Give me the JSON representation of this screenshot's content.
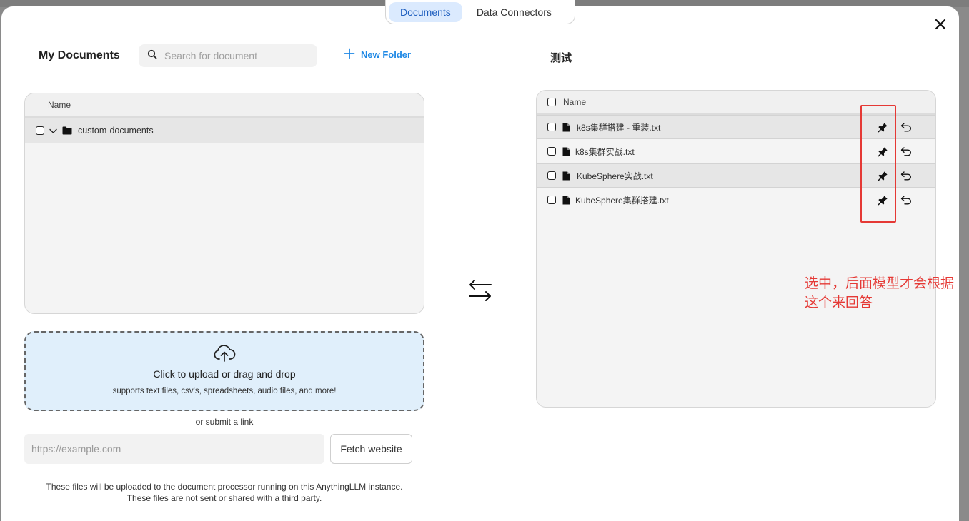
{
  "tabs": [
    {
      "label": "Documents",
      "active": true
    },
    {
      "label": "Data Connectors",
      "active": false
    }
  ],
  "my_documents": {
    "title": "My Documents",
    "search_placeholder": "Search for document",
    "new_folder_label": "New Folder",
    "column_name": "Name",
    "folders": [
      {
        "name": "custom-documents",
        "expanded": true
      }
    ]
  },
  "upload": {
    "title": "Click to upload or drag and drop",
    "subtitle": "supports text files, csv's, spreadsheets, audio files, and more!",
    "or_link": "or submit a link",
    "url_placeholder": "https://example.com",
    "fetch_label": "Fetch website",
    "disclaimer_line1": "These files will be uploaded to the document processor running on this AnythingLLM instance.",
    "disclaimer_line2": "These files are not sent or shared with a third party."
  },
  "workspace": {
    "title": "测试",
    "column_name": "Name",
    "files": [
      {
        "name": "k8s集群搭建 - 重装.txt",
        "pinned": true
      },
      {
        "name": "k8s集群实战.txt",
        "pinned": true
      },
      {
        "name": "KubeSphere实战.txt",
        "pinned": true
      },
      {
        "name": "KubeSphere集群搭建.txt",
        "pinned": true
      }
    ]
  },
  "annotation": {
    "text": "选中，后面模型才会根据这个来回答",
    "color": "#e53935"
  },
  "colors": {
    "accent": "#1e88e5",
    "active_tab_bg": "#dbeafe",
    "upload_bg": "#e0effb"
  }
}
